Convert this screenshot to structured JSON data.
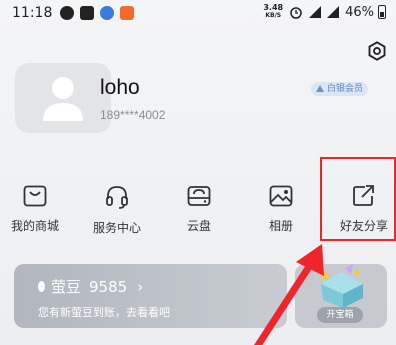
{
  "status_bar": {
    "time": "11:18",
    "net_speed_value": "3.48",
    "net_speed_unit": "KB/S",
    "battery": "46%"
  },
  "profile": {
    "username": "loho",
    "phone": "189****4002",
    "badge": "白银会员"
  },
  "menu": [
    {
      "label": "我的商城",
      "icon": "store-icon"
    },
    {
      "label": "服务中心",
      "icon": "headset-icon"
    },
    {
      "label": "云盘",
      "icon": "cloud-drive-icon"
    },
    {
      "label": "相册",
      "icon": "photo-album-icon"
    },
    {
      "label": "好友分享",
      "icon": "share-icon"
    }
  ],
  "coins": {
    "name": "萤豆",
    "count": "9585",
    "chevron": "›",
    "subtitle": "您有新萤豆到账，去看看吧"
  },
  "treasure": {
    "button": "开宝箱"
  },
  "colors": {
    "highlight": "#f0242b",
    "badge_bg": "#dbe6f4",
    "badge_text": "#5f86b8",
    "card_bg": "#b1b6bf"
  }
}
